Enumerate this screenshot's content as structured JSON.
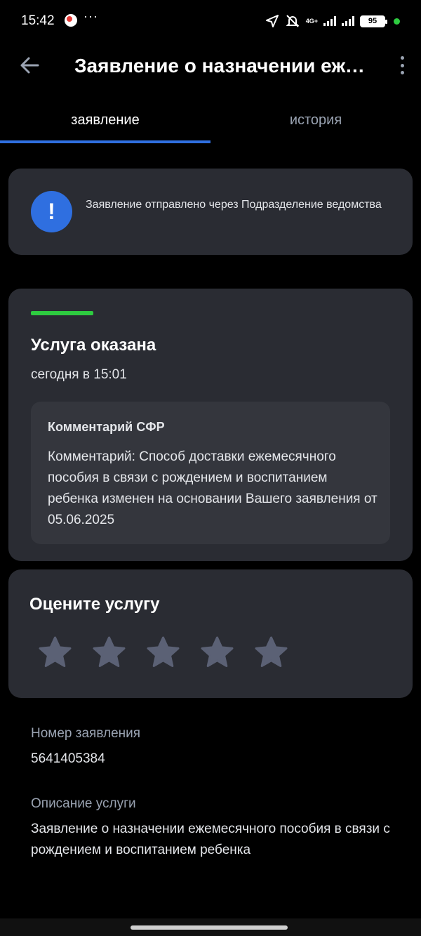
{
  "status_bar": {
    "time": "15:42",
    "more": "···",
    "network": "4G+",
    "battery": "95"
  },
  "appbar": {
    "title": "Заявление о назначении ежемесячного пособия в связи с рождением и воспитанием ребенка"
  },
  "tabs": [
    {
      "label": "заявление",
      "active": true
    },
    {
      "label": "история",
      "active": false
    }
  ],
  "notice": {
    "icon": "exclamation-icon",
    "text": "Заявление отправлено через Подразделение ведомства"
  },
  "status": {
    "accent": "#2ecc40",
    "title": "Услуга оказана",
    "time": "сегодня в 15:01",
    "comment_title": "Комментарий СФР",
    "comment_text": "Комментарий: Способ доставки ежемесячного пособия в связи с рождением и воспитанием ребенка изменен на основании Вашего заявления от 05.06.2025"
  },
  "rating": {
    "title": "Оцените услугу",
    "max": 5,
    "value": 0
  },
  "details": {
    "number_label": "Номер заявления",
    "number_value": "5641405384",
    "description_label": "Описание услуги",
    "description_value": "Заявление о назначении ежемесячного пособия в связи с рождением и воспитанием ребенка"
  },
  "colors": {
    "accent_blue": "#2f6fe0",
    "card_bg": "#2a2c33",
    "star_empty": "#5b6175"
  }
}
